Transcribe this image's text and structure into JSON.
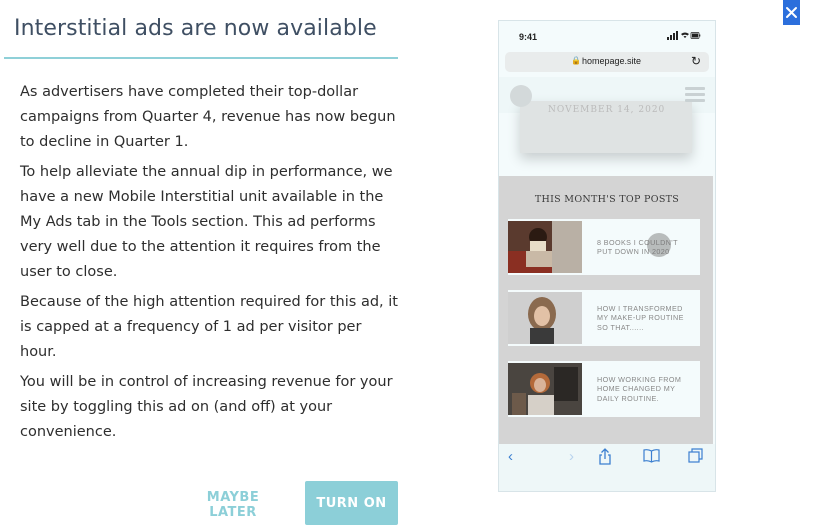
{
  "dialog": {
    "title": "Interstitial ads are now available",
    "paragraphs": [
      "As advertisers have completed their top-dollar campaigns from Quarter 4, revenue has now begun to decline in Quarter 1.",
      "To help alleviate the annual dip in performance, we have a new Mobile Interstitial unit available in the My Ads tab in the Tools section. This ad performs very well due to the attention it requires from the user to close.",
      "Because of the high attention required for this ad, it is capped at a frequency of 1 ad per visitor per hour.",
      "You will be in control of increasing revenue for your site by toggling this ad on (and off) at your convenience."
    ],
    "maybe_later_label": "MAYBE LATER",
    "turn_on_label": "TURN ON",
    "close_icon": "close-icon"
  },
  "phone": {
    "time": "9:41",
    "status_icons": "signal-wifi-battery-icons",
    "url": "homepage.site",
    "hero_caption": "NOVEMBER 14, 2020",
    "posts_heading": "THIS MONTH'S TOP POSTS",
    "posts": [
      {
        "title": "8 BOOKS I COULDN'T PUT DOWN IN 2020"
      },
      {
        "title": "HOW I TRANSFORMED MY MAKE-UP ROUTINE SO THAT......"
      },
      {
        "title": "HOW WORKING FROM HOME CHANGED MY DAILY ROUTINE."
      }
    ],
    "toolbar_icons": [
      "back-icon",
      "forward-icon",
      "share-icon",
      "bookmarks-icon",
      "tabs-icon"
    ]
  },
  "colors": {
    "accent": "#8ccfd8",
    "title": "#3f4f63",
    "close_bg": "#2c6fdc",
    "ios_blue": "#3b7fd0"
  }
}
